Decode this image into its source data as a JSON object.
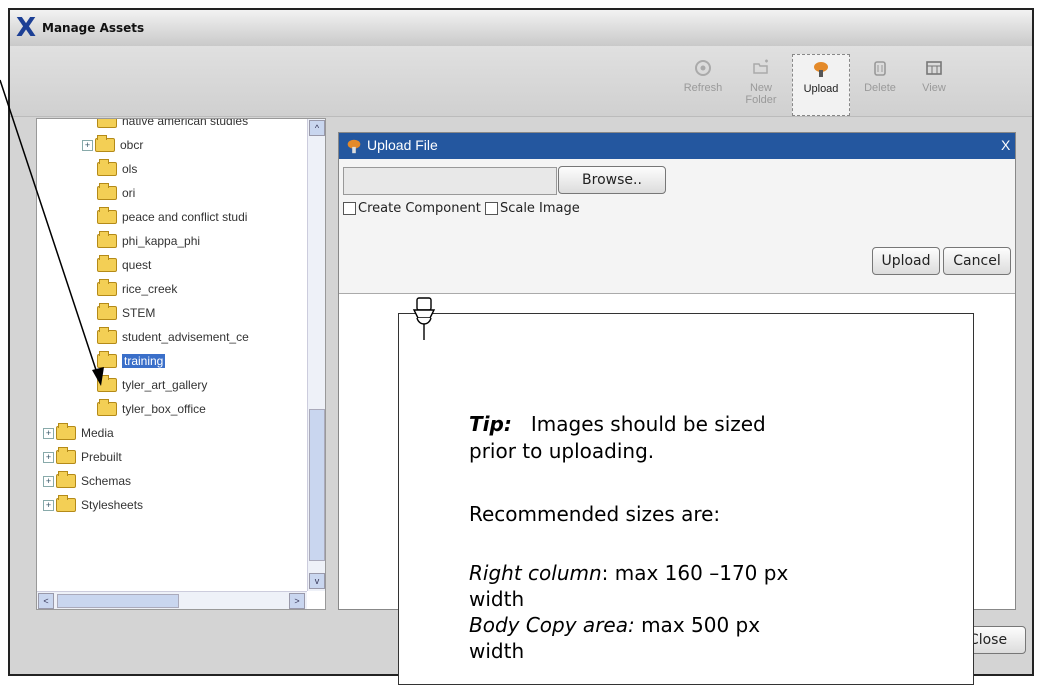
{
  "window": {
    "title": "Manage Assets",
    "logo": "X"
  },
  "toolbar": {
    "buttons": [
      {
        "label": "Refresh",
        "icon": "refresh-icon"
      },
      {
        "label": "New Folder",
        "icon": "new-folder-icon"
      },
      {
        "label": "Upload",
        "icon": "upload-icon",
        "selected": true
      },
      {
        "label": "Delete",
        "icon": "delete-icon"
      },
      {
        "label": "View",
        "icon": "view-icon"
      }
    ]
  },
  "tree": {
    "items": [
      {
        "label": "native american studies",
        "expandable": false
      },
      {
        "label": "obcr",
        "expandable": true
      },
      {
        "label": "ols",
        "expandable": false
      },
      {
        "label": "ori",
        "expandable": false
      },
      {
        "label": "peace and conflict studi",
        "expandable": false
      },
      {
        "label": "phi_kappa_phi",
        "expandable": false
      },
      {
        "label": "quest",
        "expandable": false
      },
      {
        "label": "rice_creek",
        "expandable": false
      },
      {
        "label": "STEM",
        "expandable": false
      },
      {
        "label": "student_advisement_ce",
        "expandable": false
      },
      {
        "label": "training",
        "expandable": false,
        "selected": true
      },
      {
        "label": "tyler_art_gallery",
        "expandable": false
      },
      {
        "label": "tyler_box_office",
        "expandable": false
      },
      {
        "label": "Media",
        "expandable": true
      },
      {
        "label": "Prebuilt",
        "expandable": true
      },
      {
        "label": "Schemas",
        "expandable": true
      },
      {
        "label": "Stylesheets",
        "expandable": true
      }
    ]
  },
  "upload_dialog": {
    "title": "Upload File",
    "close": "X",
    "file_value": "",
    "browse_label": "Browse..",
    "create_component_label": "Create Component",
    "scale_image_label": "Scale Image",
    "upload_label": "Upload",
    "cancel_label": "Cancel"
  },
  "footer": {
    "close_label": "Close"
  },
  "tip": {
    "heading": "Tip:",
    "line1": "Images should be sized",
    "line2": "prior to uploading.",
    "line3": "Recommended sizes are:",
    "right_col_label": "Right column",
    "right_col_value": ": max 160 –170 px",
    "right_col_unit": "width",
    "body_label": "Body Copy area:",
    "body_value": " max 500 px",
    "body_unit": "width"
  },
  "colors": {
    "dialog_title": "#24579f",
    "folder": "#f3cf55",
    "selection": "#3a6fc9"
  }
}
